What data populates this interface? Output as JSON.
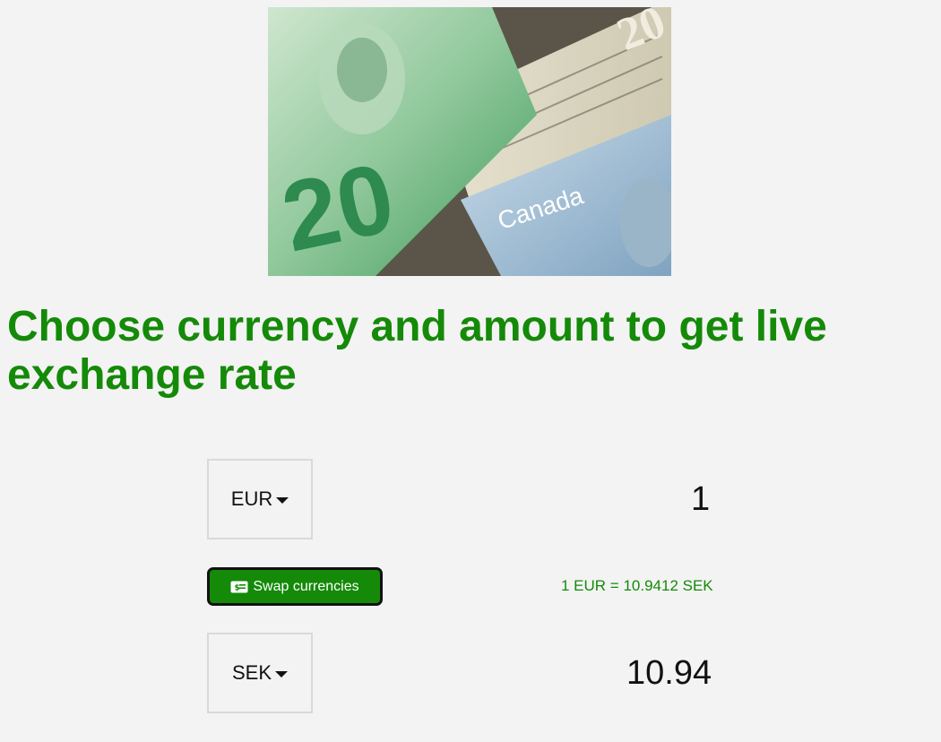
{
  "hero": {
    "image_desc_icon": "banknotes-image",
    "canadian_note_label": "Canada",
    "denomination": "20"
  },
  "page": {
    "title": "Choose currency and amount to get live exchange rate"
  },
  "converter": {
    "from": {
      "currency": "EUR",
      "amount": "1"
    },
    "swap": {
      "label": "Swap currencies",
      "icon": "money-bill-icon"
    },
    "rate_text": "1 EUR = 10.9412 SEK",
    "to": {
      "currency": "SEK",
      "amount": "10.94"
    }
  },
  "colors": {
    "accent": "#148a08",
    "background": "#f3f3f3",
    "select_border": "#d9d9d9"
  }
}
